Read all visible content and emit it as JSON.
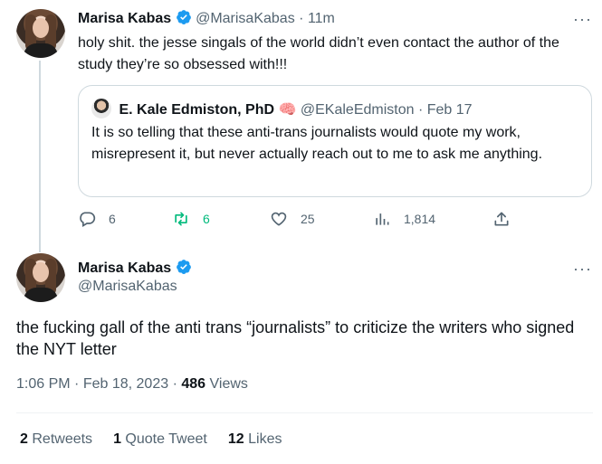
{
  "tweet1": {
    "author_name": "Marisa Kabas",
    "author_handle": "@MarisaKabas",
    "separator": "·",
    "time": "11m",
    "text": "holy shit. the jesse singals of the world didn’t even contact the author of the study they’re so obsessed with!!!",
    "quote": {
      "author_name": "E. Kale Edmiston, PhD",
      "author_emoji": "🧠",
      "author_handle": "@EKaleEdmiston",
      "separator": "·",
      "date": "Feb 17",
      "text": "It is so telling that these anti-trans journalists would quote my work, misrepresent it, but never actually reach out to me to ask me anything."
    },
    "actions": {
      "replies": "6",
      "retweets": "6",
      "likes": "25",
      "views": "1,814"
    }
  },
  "tweet2": {
    "author_name": "Marisa Kabas",
    "author_handle": "@MarisaKabas",
    "text": "the fucking gall of the anti trans “journalists” to criticize the writers who signed the NYT letter",
    "time": "1:06 PM",
    "separator": "·",
    "date": "Feb 18, 2023",
    "views_count": "486",
    "views_label": "Views",
    "retweets_count": "2",
    "retweets_label": "Retweets",
    "quote_tweets_count": "1",
    "quote_tweets_label": "Quote Tweet",
    "likes_count": "12",
    "likes_label": "Likes"
  },
  "icons": {
    "verified": "verified-badge-icon",
    "more": "more-horizontal-icon",
    "reply": "reply-icon",
    "retweet": "retweet-icon",
    "like": "heart-icon",
    "views": "bar-chart-icon",
    "share": "share-icon"
  },
  "colors": {
    "verified": "#1d9bf0",
    "retweet_active": "#00ba7c",
    "muted": "#536471",
    "border": "#cfd9de"
  }
}
